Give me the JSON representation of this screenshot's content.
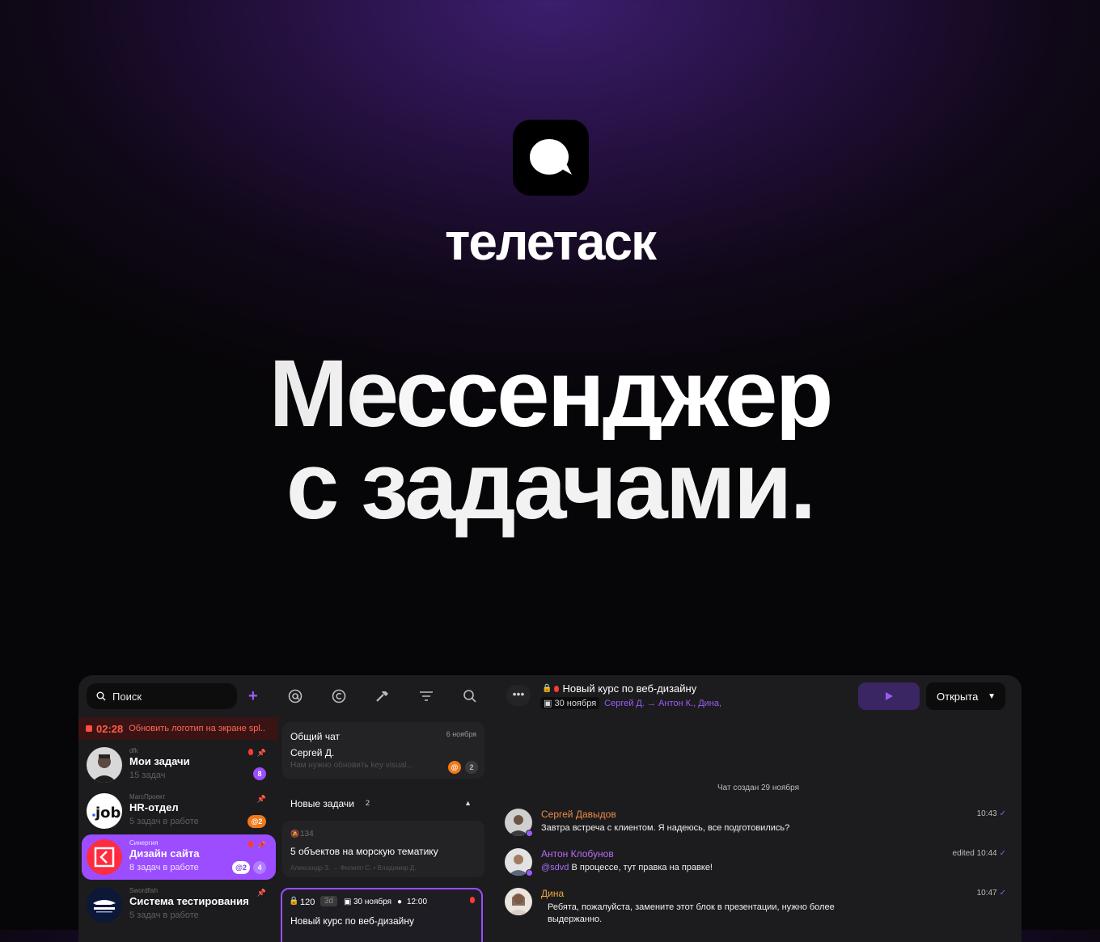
{
  "brand": {
    "name": "телетаск",
    "headline_line1": "Мессенджер",
    "headline_line2": "с задачами."
  },
  "sidebar": {
    "search_label": "Поиск",
    "add_icon": "plus-icon",
    "timer": {
      "time": "02:28",
      "text": "Обновить логотип на экране spl..."
    },
    "chats": [
      {
        "org": "dfk",
        "name": "Мои задачи",
        "sub": "15 задач",
        "badge": "8",
        "pinned": true,
        "priority": true
      },
      {
        "org": "МагсПроект",
        "name": "HR-отдел",
        "sub": "5 задач в работе",
        "badge": "@2",
        "pinned": true,
        "priority": false
      },
      {
        "org": "Синергия",
        "name": "Дизайн сайта",
        "sub": "8 задач в работе",
        "badge_mention": "@2",
        "badge_count": "4",
        "pinned": true,
        "priority": true,
        "active": true
      },
      {
        "org": "Swordfish",
        "name": "Система тестирования",
        "sub": "5 задач в работе",
        "pinned": true,
        "priority": false
      }
    ]
  },
  "toolbar": {
    "icons": [
      "at-icon",
      "copyright-icon",
      "hammer-icon",
      "filter-icon",
      "search-icon"
    ]
  },
  "tasks": {
    "general_chat": {
      "title": "Общий чат",
      "date": "6 ноября",
      "author": "Сергей Д.",
      "preview": "Нам нужно обновить key visual...",
      "badge_mention": "@",
      "badge_count": "2"
    },
    "section": {
      "title": "Новые задачи",
      "count": "2"
    },
    "task1": {
      "number": "134",
      "title": "5 объектов на морскую тематику",
      "people": "Александр З. → Филипп С. • Владимир Д."
    },
    "task2": {
      "number": "120",
      "duration": "3d",
      "date": "30 ноября",
      "time": "12:00",
      "title": "Новый курс по веб-дизайну"
    }
  },
  "chat": {
    "title": "Новый курс по веб-дизайну",
    "date": "30 ноября",
    "people": "Сергей Д.  →  Антон К., Дина,",
    "status": "Открыта",
    "created": "Чат создан 29 ноября",
    "messages": [
      {
        "author": "Сергей Давыдов",
        "text": "Завтра встреча с клиентом. Я надеюсь, все подготовились?",
        "time": "10:43",
        "color": "#f0894a"
      },
      {
        "author": "Антон Клобунов",
        "mention": "@sdvd",
        "text": "В процессе, тут правка на правке!",
        "time": "edited 10:44",
        "color": "#b66cf5"
      },
      {
        "author": "Дина",
        "text": "Ребята, пожалуйста, замените этот блок в презентации, нужно более выдержанно.",
        "time": "10:47",
        "color": "#f2a93b"
      }
    ]
  },
  "colors": {
    "accent": "#9b4dff",
    "danger": "#ff4d3d",
    "badge_orange": "#f07a1a"
  }
}
